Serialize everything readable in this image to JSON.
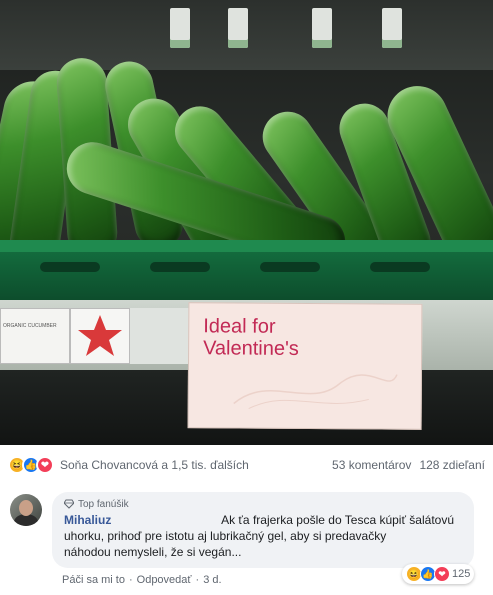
{
  "photo": {
    "sign_line1": "Ideal for",
    "sign_line2": "Valentine's",
    "shelf_label_text": "ORGANIC CUCUMBER",
    "accent_star_color": "#d9393a",
    "sign_text_color": "#c22a55"
  },
  "reactions": {
    "icons": [
      "haha-icon",
      "like-icon",
      "love-icon"
    ],
    "names": "Soňa Chovancová a 1,5 tis. ďalších",
    "comments": "53 komentárov",
    "shares": "128 zdieľaní"
  },
  "comment": {
    "badge": "Top fanúšik",
    "author": "Mihaliuz",
    "text_line1": "Ak ťa frajerka pošle do Tesca kúpiť šalátovú",
    "text_line2": "uhorku, prihoď pre istotu aj lubrikačný gel, aby si predavačky",
    "text_line3": "náhodou nemysleli, že si vegán...",
    "like_action": "Páči sa mi to",
    "reply_action": "Odpovedať",
    "time": "3 d.",
    "reaction_count": "125"
  }
}
